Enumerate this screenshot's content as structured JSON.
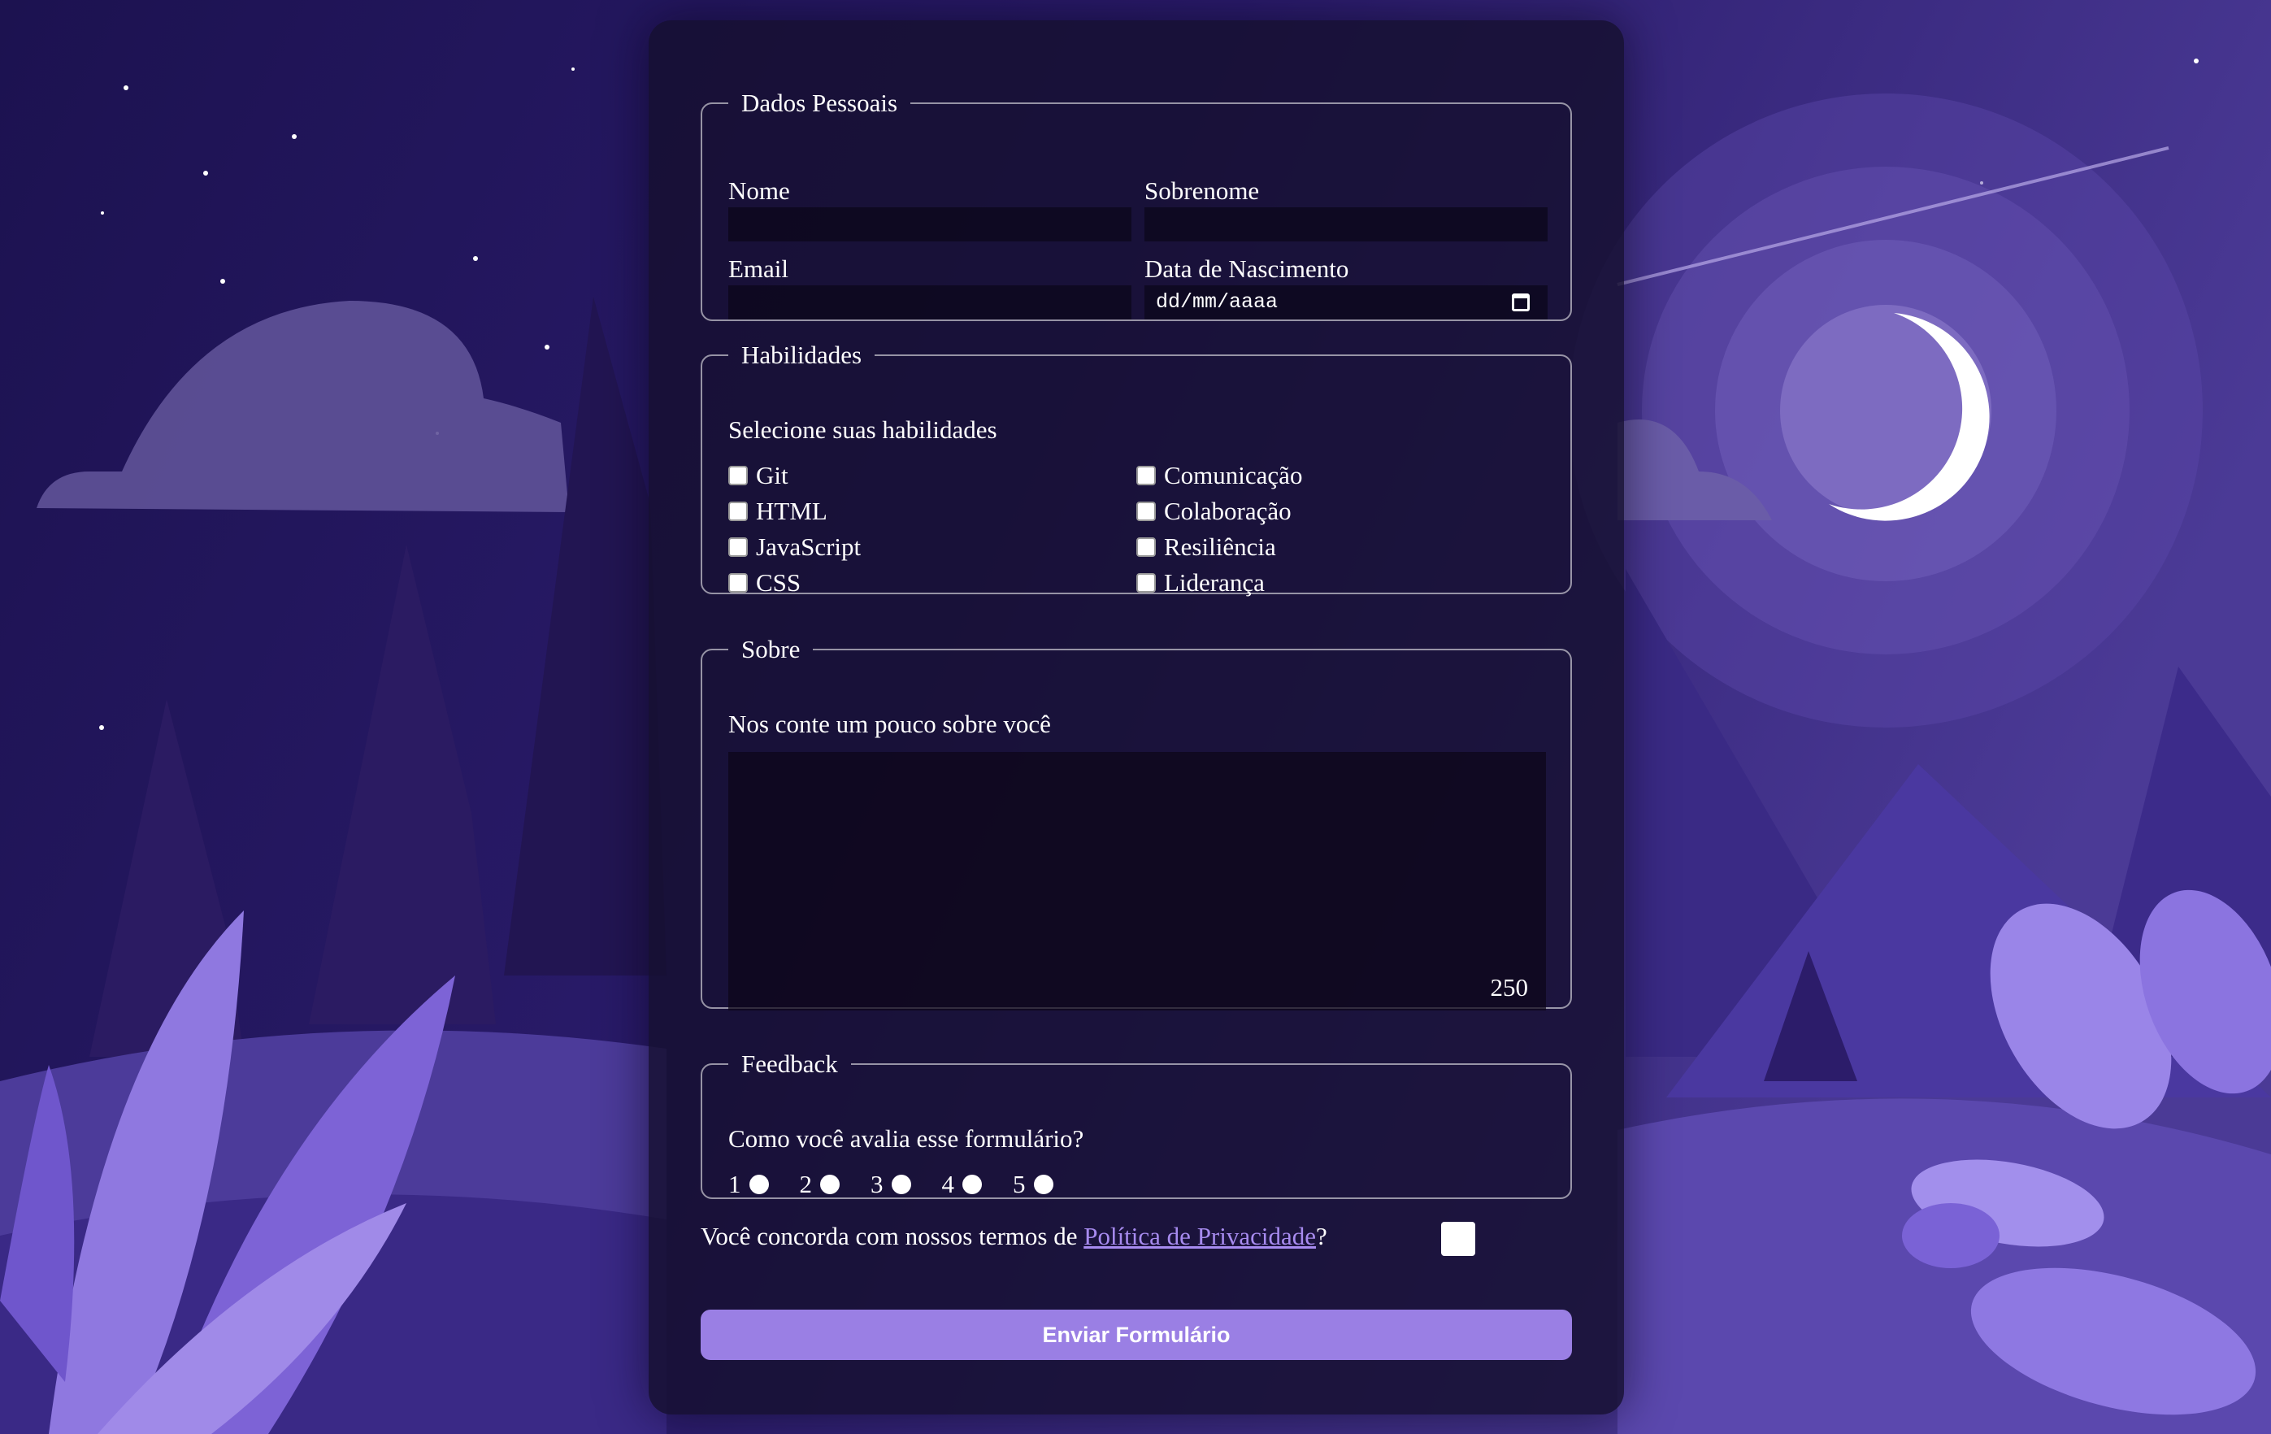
{
  "sections": {
    "personal": {
      "legend": "Dados Pessoais",
      "first_name_label": "Nome",
      "last_name_label": "Sobrenome",
      "email_label": "Email",
      "birth_label": "Data de Nascimento",
      "birth_placeholder": "dd/mm/aaaa"
    },
    "skills": {
      "legend": "Habilidades",
      "prompt": "Selecione suas habilidades",
      "left": [
        "Git",
        "HTML",
        "JavaScript",
        "CSS"
      ],
      "right": [
        "Comunicação",
        "Colaboração",
        "Resiliência",
        "Liderança"
      ]
    },
    "about": {
      "legend": "Sobre",
      "prompt": "Nos conte um pouco sobre você",
      "counter": "250"
    },
    "feedback": {
      "legend": "Feedback",
      "prompt": "Como você avalia esse formulário?",
      "ratings": [
        "1",
        "2",
        "3",
        "4",
        "5"
      ]
    }
  },
  "terms": {
    "prefix": "Você concorda com nossos termos de ",
    "link": "Política de Privacidade",
    "suffix": "?"
  },
  "submit_label": "Enviar Formulário",
  "colors": {
    "accent": "#9a7fe4",
    "link": "#a78bef"
  }
}
